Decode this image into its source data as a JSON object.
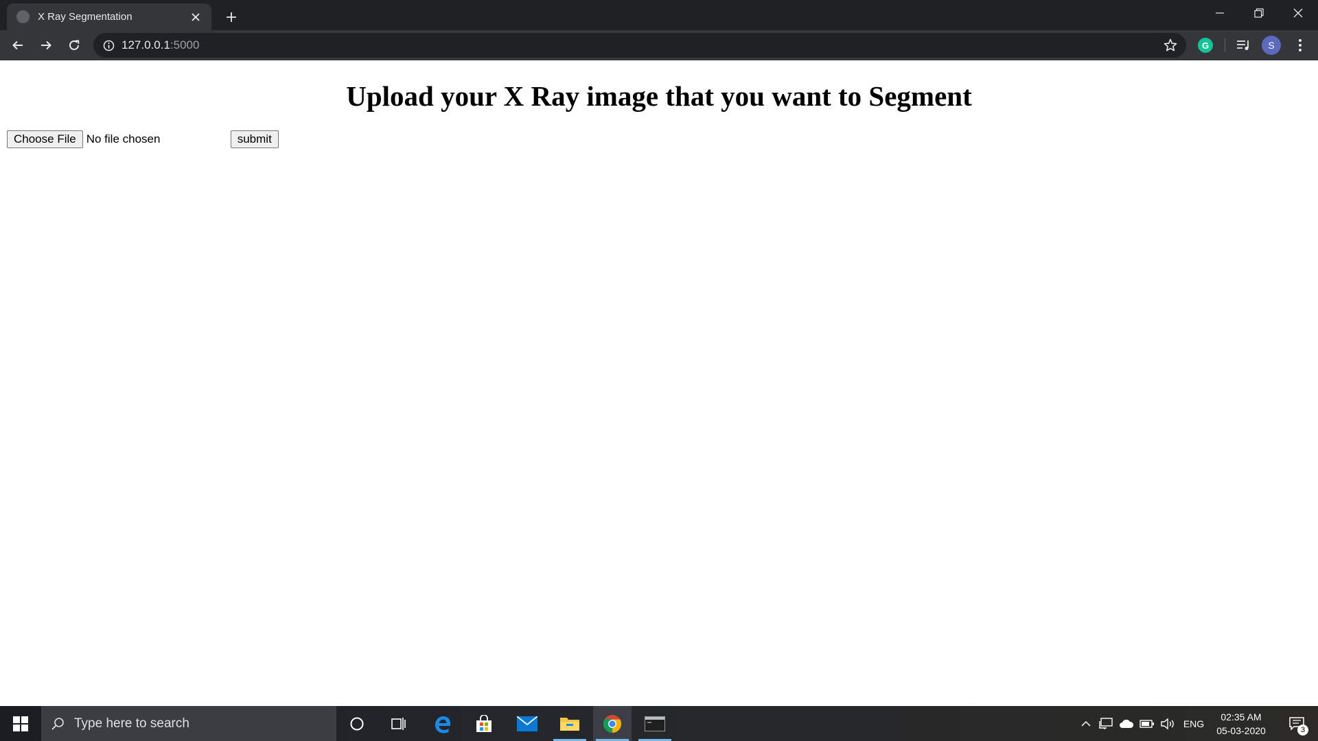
{
  "browser": {
    "tab": {
      "title": "X Ray Segmentation"
    },
    "address": {
      "host": "127.0.0.1",
      "port": ":5000"
    },
    "profile_initial": "S",
    "grammarly_letter": "G"
  },
  "page": {
    "heading": "Upload your X Ray image that you want to Segment",
    "file_input": {
      "button_label": "Choose File",
      "status": "No file chosen"
    },
    "submit_label": "submit"
  },
  "taskbar": {
    "search_placeholder": "Type here to search",
    "language": "ENG",
    "time": "02:35 AM",
    "date": "05-03-2020",
    "notification_count": "3",
    "pinned": [
      "cortana-icon",
      "task-view-icon",
      "edge-icon",
      "store-icon",
      "mail-icon",
      "file-explorer-icon",
      "chrome-icon",
      "terminal-icon"
    ]
  },
  "colors": {
    "chrome_dark": "#202124",
    "chrome_tab": "#35363a",
    "grammarly": "#15c39a",
    "avatar": "#5b6abf",
    "taskbar_accent": "#76b9ed"
  }
}
